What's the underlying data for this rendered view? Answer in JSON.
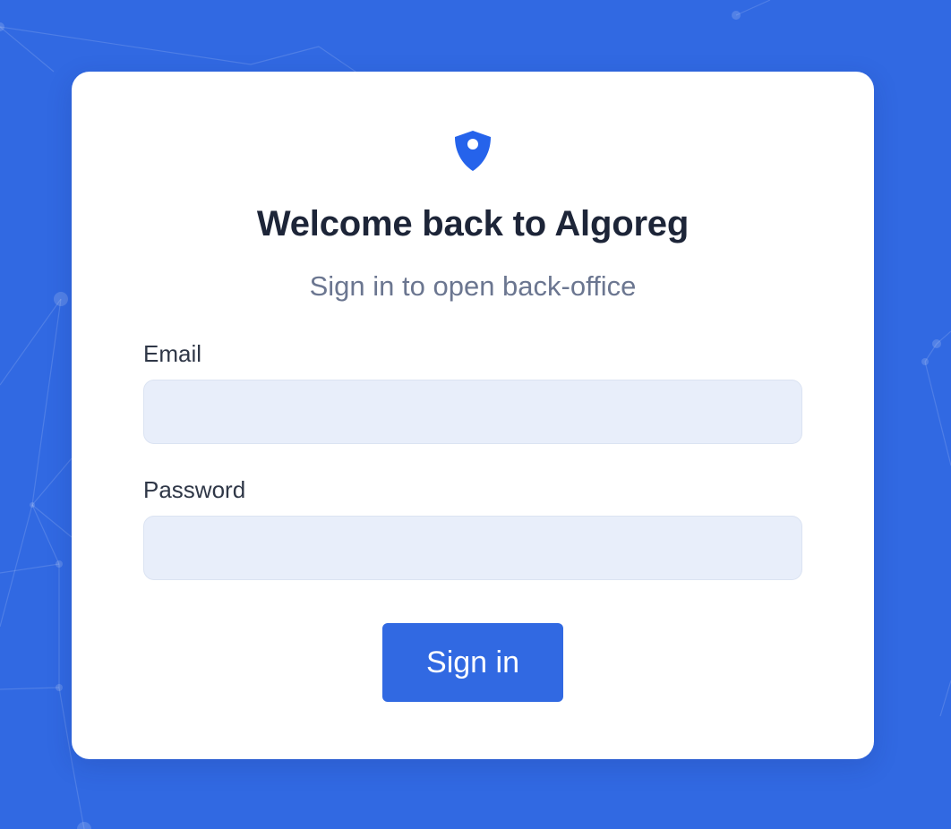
{
  "colors": {
    "background": "#3169e2",
    "card": "#ffffff",
    "accent": "#2563eb",
    "input_bg": "#e8eefa",
    "title": "#1d2538",
    "subtitle": "#6b7690"
  },
  "logo": {
    "icon": "shield-location-icon"
  },
  "header": {
    "title": "Welcome back to Algoreg",
    "subtitle": "Sign in to open back-office"
  },
  "form": {
    "email": {
      "label": "Email",
      "value": "",
      "placeholder": ""
    },
    "password": {
      "label": "Password",
      "value": "",
      "placeholder": ""
    },
    "submit_label": "Sign in"
  }
}
